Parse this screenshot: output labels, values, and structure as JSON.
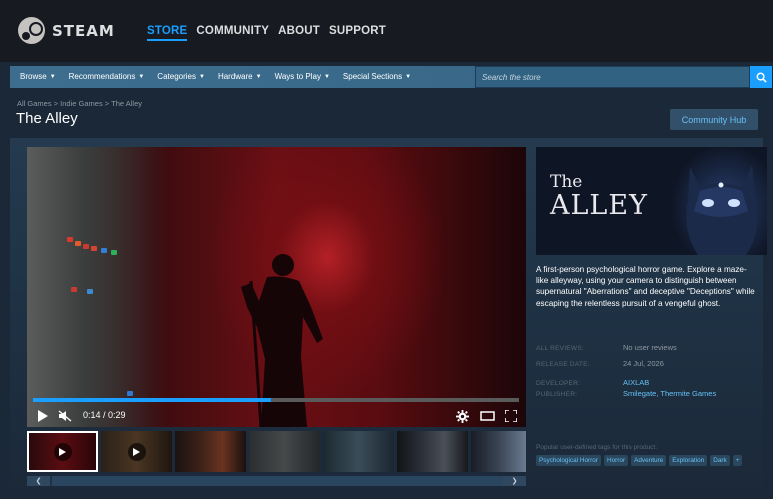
{
  "header": {
    "logo_text": "STEAM",
    "nav": [
      "STORE",
      "COMMUNITY",
      "ABOUT",
      "SUPPORT"
    ],
    "active_nav": "STORE"
  },
  "store_nav": {
    "items": [
      "Browse",
      "Recommendations",
      "Categories",
      "Hardware",
      "Ways to Play",
      "Special Sections"
    ],
    "search_placeholder": "Search the store"
  },
  "breadcrumb": {
    "items": [
      "All Games",
      "Indie Games",
      "The Alley"
    ],
    "separator": ">"
  },
  "page": {
    "title": "The Alley",
    "community_hub_label": "Community Hub"
  },
  "video": {
    "current_time": "0:14",
    "duration": "0:29",
    "time_display": "0:14 / 0:29",
    "progress": 0.49
  },
  "capsule": {
    "title_line1": "The",
    "title_line2": "ALLEY"
  },
  "description": "A first-person psychological horror game. Explore a maze-like alleyway, using your camera to distinguish between supernatural \"Aberrations\" and deceptive \"Deceptions\" while escaping the relentless pursuit of a vengeful ghost.",
  "info": {
    "reviews_label": "ALL REVIEWS:",
    "reviews_value": "No user reviews",
    "release_label": "RELEASE DATE:",
    "release_value": "24 Jul, 2026",
    "developer_label": "DEVELOPER:",
    "developer_value": "AIXLAB",
    "publisher_label": "PUBLISHER:",
    "publisher_value": "Smilegate, Thermite Games"
  },
  "tags": {
    "label": "Popular user-defined tags for this product:",
    "items": [
      "Psychological Horror",
      "Horror",
      "Adventure",
      "Exploration",
      "Dark",
      "+"
    ]
  },
  "colors": {
    "accent": "#1a9fff",
    "link": "#66c0f4",
    "background": "#1b2838",
    "header": "#171a21"
  }
}
